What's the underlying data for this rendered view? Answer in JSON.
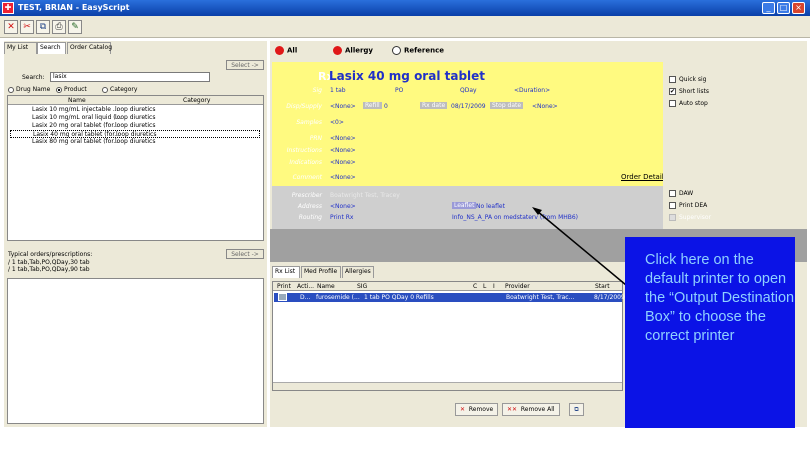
{
  "window": {
    "title": "TEST, BRIAN - EasyScript",
    "minimize": "_",
    "maximize": "□",
    "close": "×"
  },
  "toolbar": {
    "buttons": [
      {
        "name": "delete-button",
        "glyph": "✕",
        "color": "#d01010"
      },
      {
        "name": "remove-all-button",
        "glyph": "✂",
        "color": "#d01010"
      },
      {
        "name": "copy-button",
        "glyph": "⧉",
        "color": "#224488"
      },
      {
        "name": "print-button",
        "glyph": "⎙",
        "color": "#333333"
      },
      {
        "name": "sign-button",
        "glyph": "✎",
        "color": "#226622"
      }
    ]
  },
  "left": {
    "tabs": [
      "My List",
      "Search",
      "Order Catalog"
    ],
    "select_button": "Select ->",
    "search_label": "Search:",
    "search_value": "lasix",
    "radio": {
      "drug_name": "Drug Name",
      "product": "Product",
      "category": "Category"
    },
    "columns": [
      "Name",
      "Category"
    ],
    "rows": [
      [
        "Lasix 10 mg/mL injectable ...",
        "loop diuretics"
      ],
      [
        "Lasix 10 mg/mL oral liquid (...",
        "loop diuretics"
      ],
      [
        "Lasix 20 mg oral tablet (for...",
        "loop diuretics"
      ],
      [
        "Lasix 40 mg oral tablet (for...",
        "loop diuretics"
      ],
      [
        "Lasix 80 mg oral tablet (for...",
        "loop diuretics"
      ]
    ],
    "typical_label": "Typical orders/prescriptions:",
    "typical_select": "Select ->",
    "typical_items": [
      "/ 1 tab,Tab,PO,QDay,30 tab",
      "/ 1 tab,Tab,PO,QDay,90 tab"
    ]
  },
  "filters": {
    "all": "All",
    "allergy": "Allergy",
    "reference": "Reference",
    "colors": {
      "all": "#e01818",
      "allergy": "#e01818"
    }
  },
  "rx": {
    "symbol": "Rx",
    "drug": "Lasix 40 mg oral tablet",
    "sig_label": "Sig",
    "sig_qty": "1 tab",
    "sig_route": "PO",
    "sig_freq": "QDay",
    "sig_duration": "<Duration>",
    "disp_label": "Disp/Supply",
    "disp_value": "<None>",
    "refill_label": "Refill",
    "refill_value": "0",
    "rxdate_label": "Rx date",
    "rxdate_value": "08/17/2009",
    "stopdate_label": "Stop date",
    "stopdate_value": "<None>",
    "samples_label": "Samples",
    "samples_value": "<0>",
    "prn_label": "PRN",
    "prn_value": "<None>",
    "instructions_label": "Instructions",
    "instructions_value": "<None>",
    "indications_label": "Indications",
    "indications_value": "<None>",
    "comment_label": "Comment",
    "comment_value": "<None>",
    "order_details": "Order Details ▾",
    "prescriber_label": "Prescriber",
    "prescriber_value": "Boatwright Test, Tracey",
    "address_label": "Address",
    "address_value": "<None>",
    "leaflet_label": "Leaflet",
    "leaflet_value": "No leaflet",
    "routing_label": "Routing",
    "routing_print": "Print Rx",
    "routing_dest": "Info_NS_A_PA on medstaterv (from MHB6)"
  },
  "options": {
    "quick_sig": "Quick sig",
    "short_lists": "Short lists",
    "auto_stop": "Auto stop",
    "daw": "DAW",
    "print_dea": "Print DEA",
    "third": "Supervisor",
    "check": "✔"
  },
  "bottom": {
    "tabs": [
      "Rx List",
      "Med Profile",
      "Allergies"
    ],
    "columns": [
      "Print",
      "Acti...",
      "Name",
      "SIG",
      "C",
      "L",
      "I",
      "Provider",
      "Start"
    ],
    "row": {
      "action": "D...",
      "name": "furosemide (...",
      "sig": "1 tab PO QDay 0 Refills",
      "provider": "Boatwright Test, Trac...",
      "start": "8/17/2009"
    },
    "remove": "Remove",
    "remove_all": "Remove All"
  },
  "callout": {
    "text": "Click here on the default printer to open the “Output Destination Box” to choose the correct printer",
    "bg": "#0b13e6",
    "color": "#8fd0ff"
  }
}
